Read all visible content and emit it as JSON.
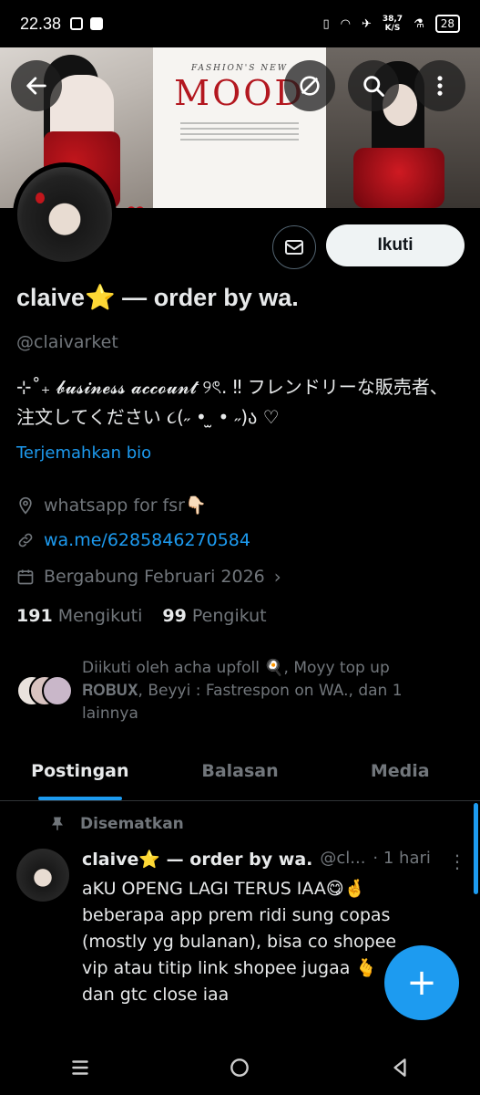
{
  "status_bar": {
    "time": "22.38",
    "speed_value": "38,7",
    "speed_unit": "K/S",
    "battery": "28"
  },
  "banner": {
    "magazine_kicker": "FASHION'S NEW",
    "magazine_title": "MOOD"
  },
  "profile": {
    "name": "claive⭐ — order by wa.",
    "handle": "@claivarket",
    "bio": "⊹˚₊ 𝓫𝓾𝓼𝓲𝓷𝓮𝓼𝓼 𝓪𝓬𝓬𝓸𝓾𝓷𝓽 ୨ৎ. ‼ フレンドリーな販売者、注文してください ૮(˶ • ̫ • ˶)ა ♡",
    "translate_label": "Terjemahkan bio",
    "location": "whatsapp for fsr👇🏻",
    "website": "wa.me/6285846270584",
    "joined": "Bergabung Februari 2026",
    "following_count": "191",
    "following_label": "Mengikuti",
    "followers_count": "99",
    "followers_label": "Pengikut",
    "followed_by": "Diikuti oleh acha upfoll 🍳, Moyy top up 𝐑𝐎𝐁𝐔𝐗, Beyyi : Fastrespon on WA., dan 1 lainnya",
    "follow_button": "Ikuti"
  },
  "tabs": [
    {
      "label": "Postingan",
      "active": true
    },
    {
      "label": "Balasan",
      "active": false
    },
    {
      "label": "Media",
      "active": false
    }
  ],
  "post": {
    "pinned_label": "Disematkan",
    "author": "claive⭐ — order by wa.",
    "handle": "@cl...",
    "time": "· 1 hari",
    "text": "aKU OPENG LAGI TERUS IAA😋🤞 beberapa app prem ridi sung copas (mostly yg bulanan), bisa co shopee vip atau titip link shopee jugaa 🫰 dan gtc close iaa"
  },
  "colors": {
    "accent": "#1d9bf0",
    "background": "#000000",
    "secondary_text": "#71767b"
  }
}
